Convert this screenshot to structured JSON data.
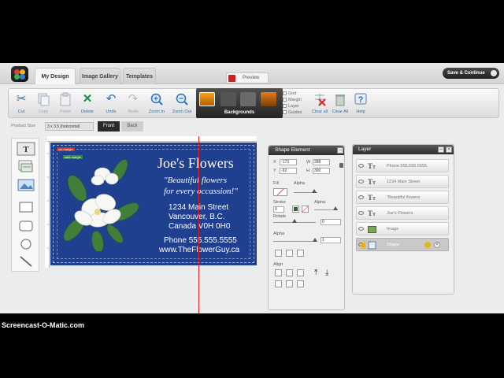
{
  "nav": {
    "tabs": [
      {
        "label": "My Design"
      },
      {
        "label": "Image Gallery"
      },
      {
        "label": "Templates"
      }
    ],
    "preview_label": "Preview",
    "save_label": "Save & Continue"
  },
  "toolbar": {
    "buttons": [
      {
        "label": "Cut",
        "icon": "scissors-icon"
      },
      {
        "label": "Copy",
        "icon": "copy-icon"
      },
      {
        "label": "Paste",
        "icon": "paste-icon"
      },
      {
        "label": "Delete",
        "icon": "delete-icon"
      },
      {
        "label": "Undo",
        "icon": "undo-icon"
      },
      {
        "label": "Redo",
        "icon": "redo-icon"
      },
      {
        "label": "Zoom In",
        "icon": "zoom-in-icon"
      },
      {
        "label": "Zoom Out",
        "icon": "zoom-out-icon"
      }
    ],
    "backgrounds_label": "Backgrounds",
    "guides": [
      {
        "label": "Grid"
      },
      {
        "label": "Margin"
      },
      {
        "label": "Layer"
      },
      {
        "label": "Guides"
      }
    ],
    "clear_all_label": "Clear all",
    "clear_all2_label": "Clear All",
    "help_label": "Help"
  },
  "product": {
    "size_label": "Product Size",
    "size_value": "3 x 3.5 (horizontal)",
    "front_label": "Front",
    "back_label": "Back"
  },
  "card": {
    "title": "Joe's Flowers",
    "tagline1": "\"Beautiful flowers",
    "tagline2": "for every occassion!\"",
    "address1": "1234 Main Street",
    "address2": "Vancouver, B.C.",
    "address3": "Canada V0H 0H0",
    "phone": "Phone 555.555.5555",
    "website": "www.TheFlowerGuy.ca",
    "tag_cut": "cut margin",
    "tag_safe": "safe margin",
    "background_color": "#1f3f8f"
  },
  "shape_panel": {
    "title": "Shape Element",
    "x_label": "X",
    "x_value": "-173",
    "w_label": "W",
    "w_value": "288",
    "y_label": "Y",
    "y_value": "-92",
    "h_label": "H",
    "h_value": "300",
    "fill_label": "Fill",
    "alpha_label": "Alpha",
    "stroke_label": "Stroke",
    "stroke_value": "0",
    "alpha2_label": "Alpha",
    "rotate_label": "Rotate",
    "rotate_value": "0",
    "alpha3_label": "Alpha",
    "alpha3_value": "1",
    "align_label": "Align",
    "stroke_color": "#1e6e2e"
  },
  "layer_panel": {
    "title": "Layer",
    "layers": [
      {
        "label": "Phone 555.555.5555",
        "icon": "text-layer-icon"
      },
      {
        "label": "1234 Main Street",
        "icon": "text-layer-icon"
      },
      {
        "label": "\"Beautiful flowers",
        "icon": "text-layer-icon"
      },
      {
        "label": "Joe's Flowers",
        "icon": "text-layer-icon"
      },
      {
        "label": "Image",
        "icon": "image-layer-icon"
      },
      {
        "label": "Shape",
        "icon": "shape-layer-icon"
      }
    ]
  },
  "watermark": "Screencast-O-Matic.com"
}
